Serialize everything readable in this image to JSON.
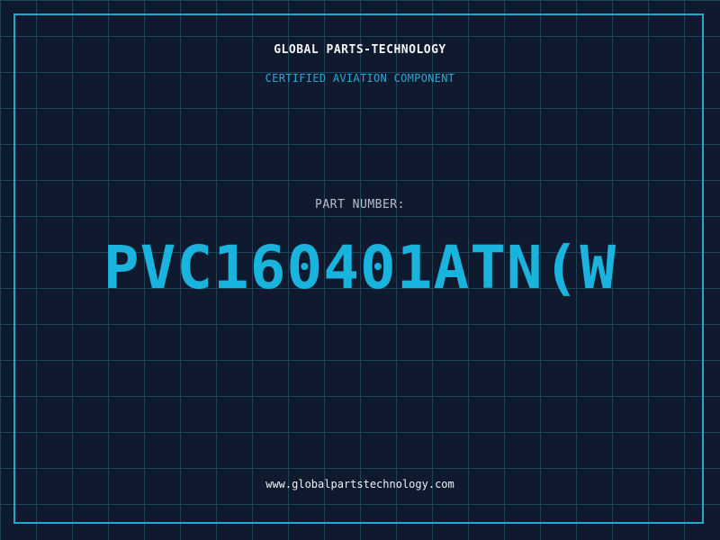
{
  "header": {
    "company": "GLOBAL PARTS-TECHNOLOGY",
    "tagline": "CERTIFIED AVIATION COMPONENT"
  },
  "part": {
    "label": "PART NUMBER:",
    "number": "PVC160401ATN(W"
  },
  "footer": {
    "website": "www.globalpartstechnology.com"
  },
  "colors": {
    "background": "#101a2e",
    "grid": "#1d4259",
    "accent": "#21a8d0",
    "part_number": "#19b3de"
  }
}
